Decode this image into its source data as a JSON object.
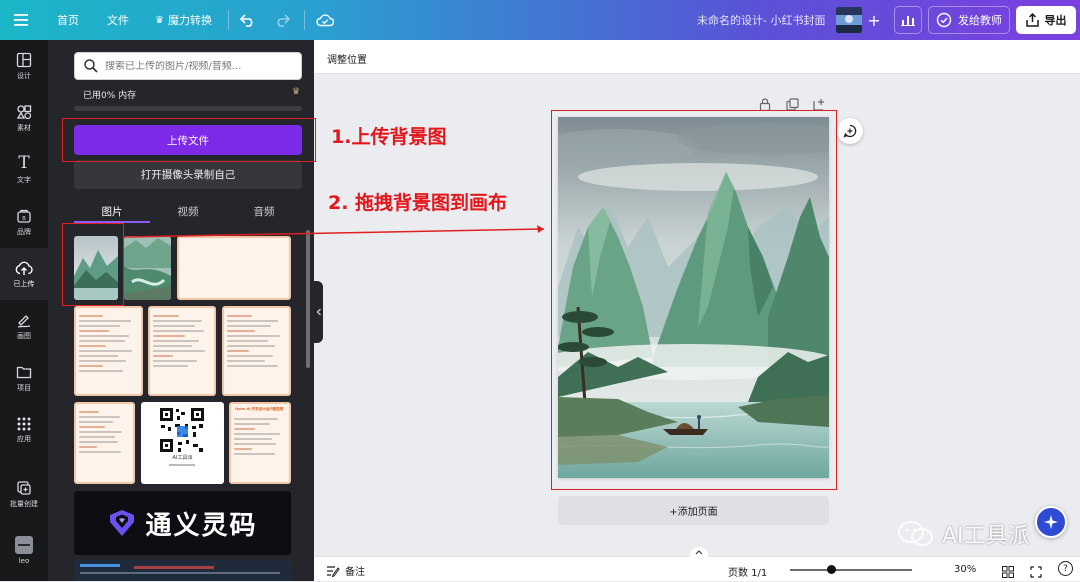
{
  "topbar": {
    "home": "首页",
    "file": "文件",
    "magic": "魔力转换",
    "doc_title": "未命名的设计- 小红书封面",
    "share_teacher": "发给教师",
    "export": "导出"
  },
  "rail": [
    {
      "label": "设计",
      "icon": "layout-icon"
    },
    {
      "label": "素材",
      "icon": "elements-icon"
    },
    {
      "label": "文字",
      "icon": "text-icon"
    },
    {
      "label": "品牌",
      "icon": "brand-icon"
    },
    {
      "label": "已上传",
      "icon": "upload-cloud-icon"
    },
    {
      "label": "画图",
      "icon": "draw-icon"
    },
    {
      "label": "项目",
      "icon": "folder-icon"
    },
    {
      "label": "应用",
      "icon": "apps-icon"
    },
    {
      "label": "批量创建",
      "icon": "bulk-create-icon"
    },
    {
      "label": "leo",
      "icon": "avatar"
    }
  ],
  "panel": {
    "search_placeholder": "搜索已上传的图片/视频/音频...",
    "storage": "已用0% 内存",
    "upload_btn": "上传文件",
    "record_btn": "打开摄像头录制自己",
    "tabs": [
      "图片",
      "视频",
      "音频"
    ],
    "tongyi": "通义灵码",
    "qr_caption": "AI工具派",
    "doc_header": "Open AI 开发者大会问题整理"
  },
  "editor": {
    "position_label": "调整位置",
    "add_page": "+添加页面",
    "notes": "备注",
    "page_counter": "页数 1/1",
    "zoom": "30%",
    "help": "?"
  },
  "annotations": {
    "step1": "1.上传背景图",
    "step2": "2. 拖拽背景图到画布"
  },
  "watermark": "AI工具派",
  "colors": {
    "accent_purple": "#7d2ae8",
    "annotation_red": "#e3161b",
    "rail_bg": "#18191b",
    "panel_bg": "#25262b"
  }
}
